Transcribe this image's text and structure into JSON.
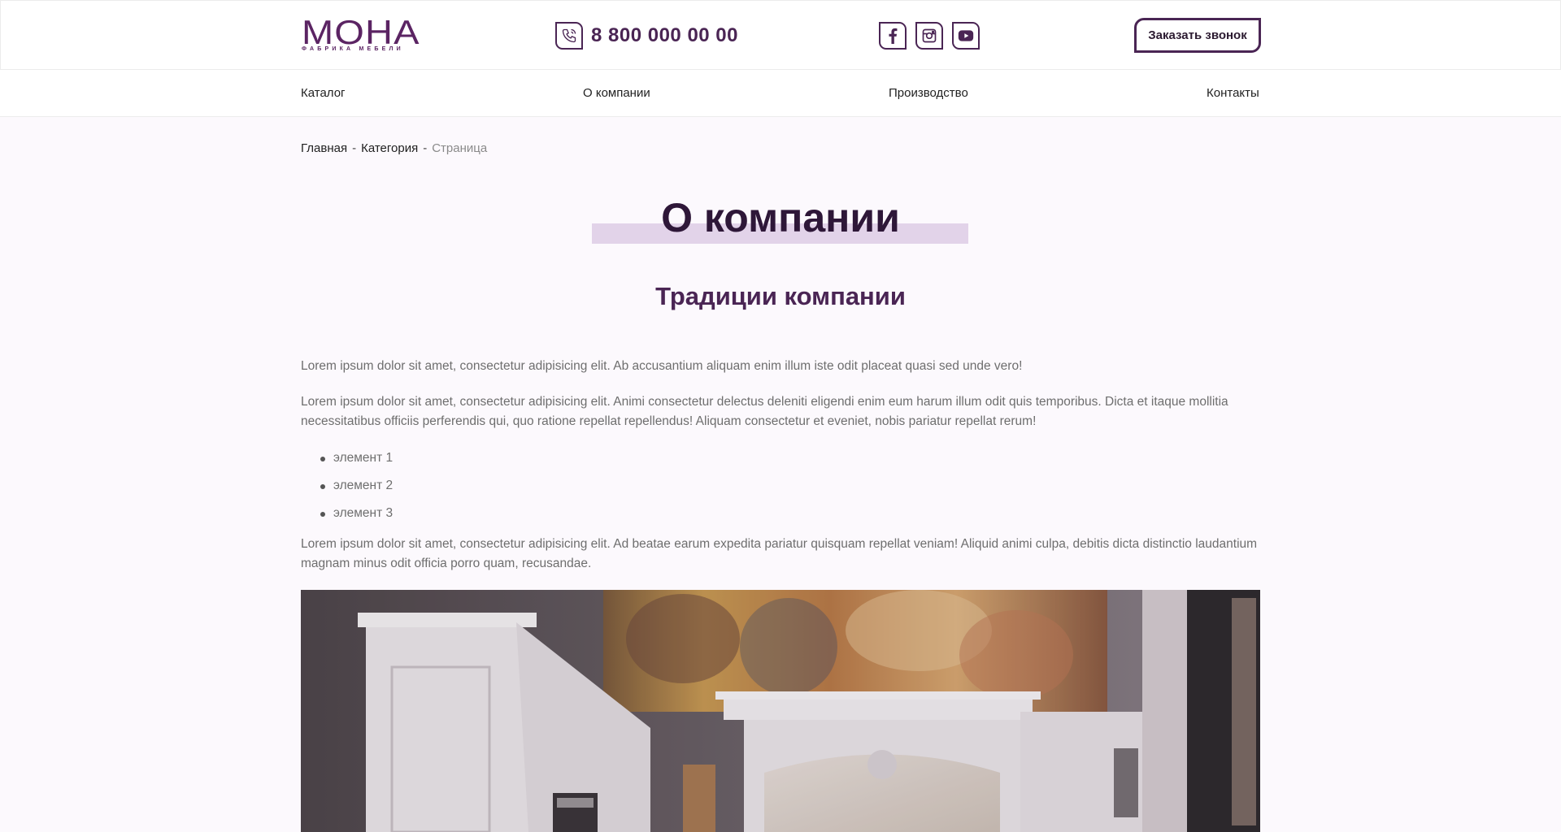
{
  "header": {
    "logo_main": "МОНА",
    "logo_sub": "ФАБРИКА МЕБЕЛИ",
    "phone": "8 800 000 00 00",
    "socials": [
      "facebook-icon",
      "instagram-icon",
      "youtube-icon"
    ],
    "callback_label": "Заказать звонок"
  },
  "nav": {
    "items": [
      {
        "label": "Каталог"
      },
      {
        "label": "О компании"
      },
      {
        "label": "Производство"
      },
      {
        "label": "Контакты"
      }
    ]
  },
  "breadcrumb": {
    "items": [
      "Главная",
      "Категория"
    ],
    "separator": "-",
    "current": "Страница"
  },
  "main": {
    "title": "О компании",
    "subtitle": "Традиции компании",
    "paragraphs": [
      "Lorem ipsum dolor sit amet, consectetur adipisicing elit. Ab accusantium aliquam enim illum iste odit placeat quasi sed unde vero!",
      "Lorem ipsum dolor sit amet, consectetur adipisicing elit. Animi consectetur delectus deleniti eligendi enim eum harum illum odit quis temporibus. Dicta et itaque mollitia necessitatibus officiis perferendis qui, quo ratione repellat repellendus! Aliquam consectetur et eveniet, nobis pariatur repellat rerum!",
      "Lorem ipsum dolor sit amet, consectetur adipisicing elit. Ad beatae earum expedita pariatur quisquam repellat veniam! Aliquid animi culpa, debitis dicta distinctio laudantium magnam minus odit officia porro quam, recusandae."
    ],
    "list": [
      "элемент 1",
      "элемент 2",
      "элемент 3"
    ]
  },
  "colors": {
    "brand": "#4a2554",
    "title_highlight": "#e2d3e9",
    "background": "#fcf9fd"
  }
}
